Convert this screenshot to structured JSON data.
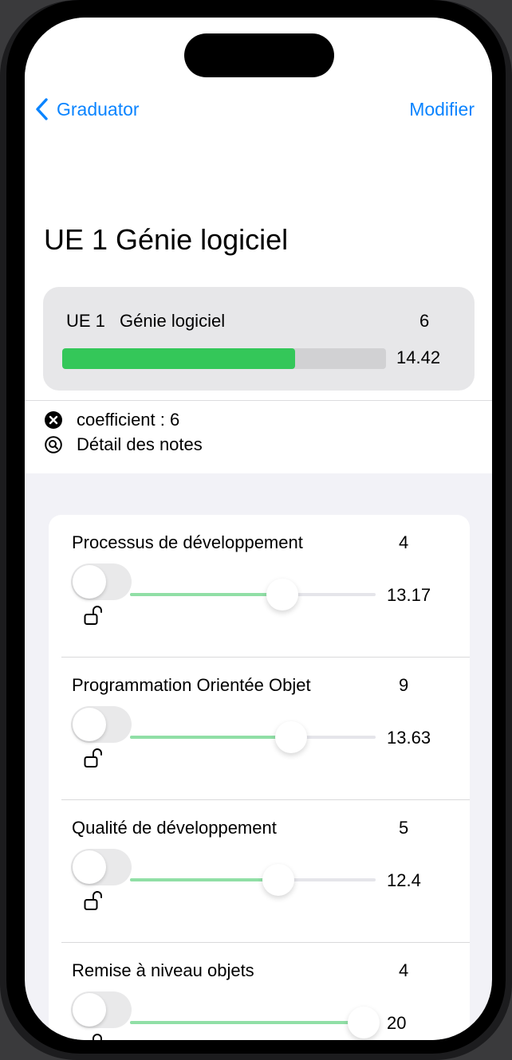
{
  "nav": {
    "back_label": "Graduator",
    "edit_label": "Modifier"
  },
  "page": {
    "title": "UE 1 Génie logiciel"
  },
  "summary": {
    "code": "UE 1",
    "name": "Génie logiciel",
    "coefficient": "6",
    "grade": "14.42",
    "progress": 0.72,
    "bar_color": "#34c759"
  },
  "info": {
    "coefficient_text": "coefficient : 6",
    "detail_text": "Détail des notes"
  },
  "subjects": [
    {
      "name": "Processus de développement",
      "coefficient": "4",
      "grade": "13.17",
      "slider_value": 0.62,
      "toggle_on": false,
      "locked": false
    },
    {
      "name": "Programmation Orientée Objet",
      "coefficient": "9",
      "grade": "13.63",
      "slider_value": 0.655,
      "toggle_on": false,
      "locked": false
    },
    {
      "name": "Qualité de développement",
      "coefficient": "5",
      "grade": "12.4",
      "slider_value": 0.605,
      "toggle_on": false,
      "locked": false
    },
    {
      "name": "Remise à niveau objets",
      "coefficient": "4",
      "grade": "20",
      "slider_value": 0.95,
      "toggle_on": false,
      "locked": false
    }
  ],
  "colors": {
    "accent": "#0a84ff",
    "slider_fill": "#90dfa6",
    "progress": "#34c759"
  }
}
